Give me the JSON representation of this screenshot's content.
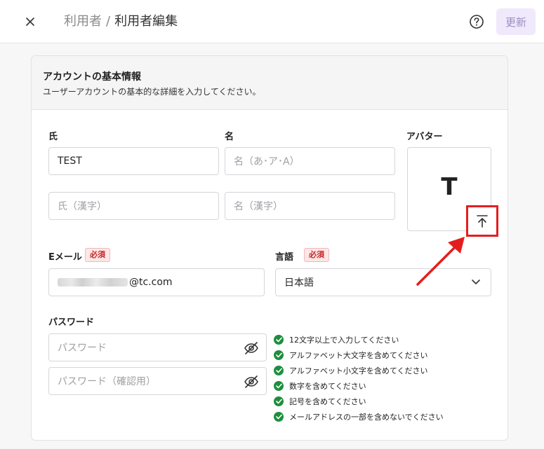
{
  "header": {
    "breadcrumb_parent": "利用者",
    "breadcrumb_sep": "/",
    "breadcrumb_current": "利用者編集",
    "update_label": "更新"
  },
  "card": {
    "title": "アカウントの基本情報",
    "subtitle": "ユーザーアカウントの基本的な詳細を入力してください。"
  },
  "form": {
    "last_name_label": "氏",
    "last_name_value": "TEST",
    "first_name_label": "名",
    "first_name_placeholder": "名（あ･ア･A）",
    "last_name_kanji_placeholder": "氏（漢字）",
    "first_name_kanji_placeholder": "名（漢字）",
    "avatar_label": "アバター",
    "avatar_initial": "T",
    "email_label": "Eメール",
    "email_required": "必須",
    "email_domain": "@tc.com",
    "language_label": "言語",
    "language_required": "必須",
    "language_value": "日本語",
    "password_label": "パスワード",
    "password_placeholder": "パスワード",
    "password_confirm_placeholder": "パスワード（確認用）"
  },
  "password_rules": [
    "12文字以上で入力してください",
    "アルファベット大文字を含めてください",
    "アルファベット小文字を含めてください",
    "数字を含めてください",
    "記号を含めてください",
    "メールアドレスの一部を含めないでください"
  ],
  "colors": {
    "accent_soft": "#efe9fb",
    "required": "#c62828",
    "rule_check": "#1e8e3e",
    "annotation": "#e41e1e"
  }
}
